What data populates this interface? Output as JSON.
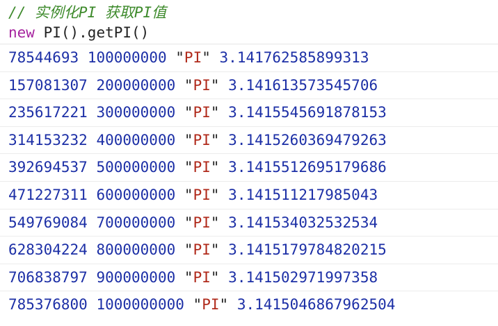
{
  "console": {
    "comment": "// 实例化PI 获取PI值",
    "code": {
      "keyword": "new",
      "expression": " PI().getPI()"
    },
    "rows": [
      {
        "n": "78544693",
        "total": "100000000",
        "label": "PI",
        "value": "3.141762585899313"
      },
      {
        "n": "157081307",
        "total": "200000000",
        "label": "PI",
        "value": "3.141613573545706"
      },
      {
        "n": "235617221",
        "total": "300000000",
        "label": "PI",
        "value": "3.1415545691878153"
      },
      {
        "n": "314153232",
        "total": "400000000",
        "label": "PI",
        "value": "3.1415260369479263"
      },
      {
        "n": "392694537",
        "total": "500000000",
        "label": "PI",
        "value": "3.1415512695179686"
      },
      {
        "n": "471227311",
        "total": "600000000",
        "label": "PI",
        "value": "3.141511217985043"
      },
      {
        "n": "549769084",
        "total": "700000000",
        "label": "PI",
        "value": "3.141534032532534"
      },
      {
        "n": "628304224",
        "total": "800000000",
        "label": "PI",
        "value": "3.1415179784820215"
      },
      {
        "n": "706838797",
        "total": "900000000",
        "label": "PI",
        "value": "3.141502971997358"
      },
      {
        "n": "785376800",
        "total": "1000000000",
        "label": "PI",
        "value": "3.1415046867962504"
      }
    ],
    "colors": {
      "comment": "#3d8a2b",
      "keyword": "#a6249f",
      "number": "#1c2fa6",
      "string": "#b02a1b"
    }
  }
}
